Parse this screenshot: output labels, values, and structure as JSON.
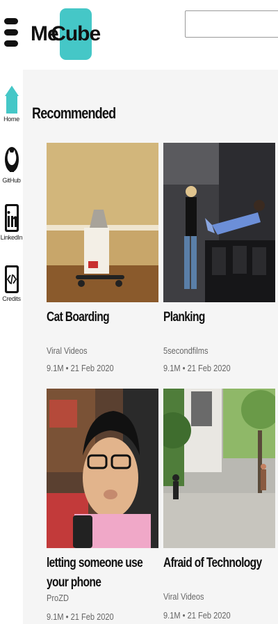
{
  "header": {
    "logo_me": "Me",
    "logo_cube": "Cube",
    "search_placeholder": ""
  },
  "sidebar": {
    "items": [
      {
        "label": "Home",
        "icon": "home-icon"
      },
      {
        "label": "GitHub",
        "icon": "github-icon"
      },
      {
        "label": "LinkedIn",
        "icon": "linkedin-icon"
      },
      {
        "label": "Credits",
        "icon": "code-icon"
      }
    ]
  },
  "main": {
    "section_title": "Recommended",
    "videos": [
      {
        "title": "Cat Boarding",
        "channel": "Viral Videos",
        "views": "9.1M",
        "separator": "•",
        "date": "21 Feb 2020"
      },
      {
        "title": "Planking",
        "channel": "5secondfilms",
        "views": "9.1M",
        "separator": "•",
        "date": "21 Feb 2020"
      },
      {
        "title": "letting someone use your phone",
        "channel": "ProZD",
        "views": "9.1M",
        "separator": "•",
        "date": "21 Feb 2020"
      },
      {
        "title": "Afraid of Technology",
        "channel": "Viral Videos",
        "views": "9.1M",
        "separator": "•",
        "date": "21 Feb 2020"
      }
    ]
  },
  "colors": {
    "accent": "#45c7c7",
    "main_bg": "#f5f5f5"
  }
}
